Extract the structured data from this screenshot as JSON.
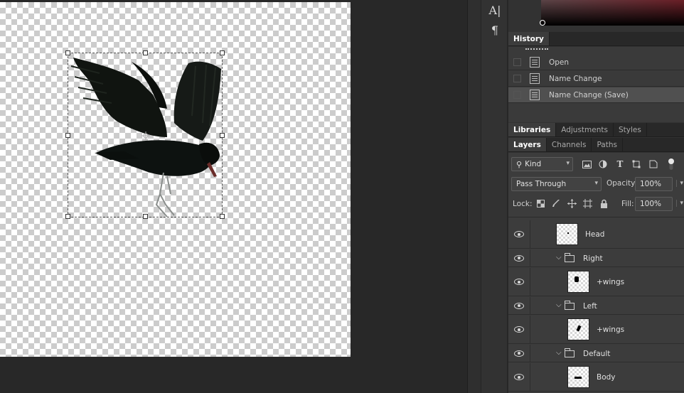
{
  "tool_strip": {
    "tools": [
      {
        "icon": "character-panel-icon",
        "glyph": "A|"
      },
      {
        "icon": "paragraph-icon",
        "glyph": "¶"
      }
    ]
  },
  "history_panel": {
    "tab": "History",
    "items": [
      {
        "label": "Open",
        "selected": false
      },
      {
        "label": "Name Change",
        "selected": false
      },
      {
        "label": "Name Change (Save)",
        "selected": true
      }
    ]
  },
  "library_tabs": [
    "Libraries",
    "Adjustments",
    "Styles"
  ],
  "layers_tabs": [
    "Layers",
    "Channels",
    "Paths"
  ],
  "layers_panel": {
    "filter": {
      "value": "Kind"
    },
    "blend_mode": "Pass Through",
    "opacity_label": "Opacity:",
    "opacity_value": "100%",
    "lock_label": "Lock:",
    "fill_label": "Fill:",
    "fill_value": "100%",
    "layers": [
      {
        "name": "Head",
        "type": "layer",
        "visible": true
      },
      {
        "name": "Right",
        "type": "group",
        "visible": true
      },
      {
        "name": "+wings",
        "type": "layer",
        "visible": true
      },
      {
        "name": "Left",
        "type": "group",
        "visible": true
      },
      {
        "name": "+wings",
        "type": "layer",
        "visible": true
      },
      {
        "name": "Default",
        "type": "group",
        "visible": true
      },
      {
        "name": "Body",
        "type": "layer",
        "visible": true
      }
    ]
  },
  "colors": {
    "workspace": "#282828",
    "panel": "#323232",
    "selected_row": "#505050",
    "picker_hue": "#6a1f27"
  }
}
